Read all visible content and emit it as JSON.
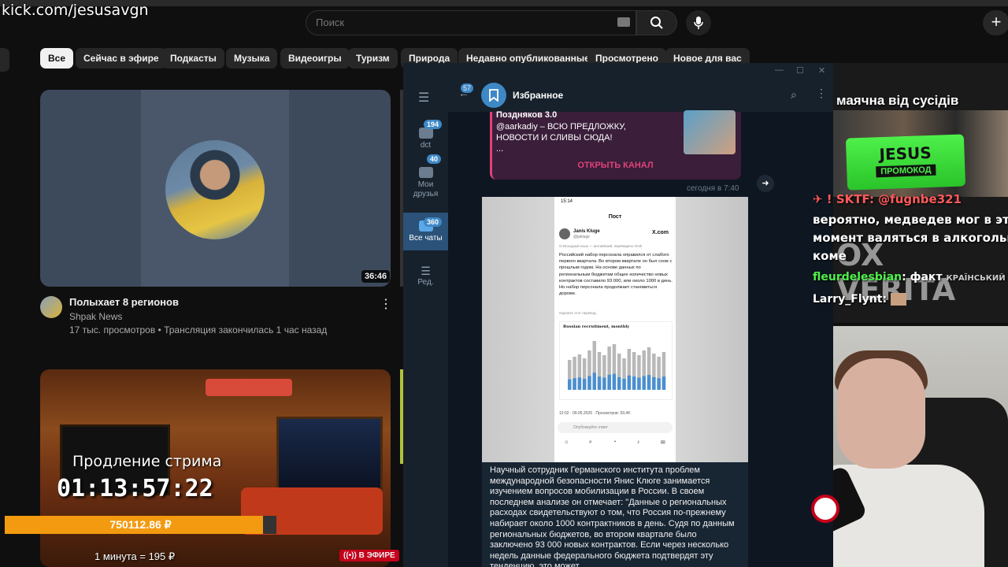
{
  "watermark": "kick.com/jesusavgn",
  "search": {
    "placeholder": "Поиск"
  },
  "chips": [
    "Все",
    "Сейчас в эфире",
    "Подкасты",
    "Музыка",
    "Видеоигры",
    "Туризм",
    "Природа",
    "Недавно опубликованные",
    "Просмотрено",
    "Новое для вас"
  ],
  "video1": {
    "duration": "36:46",
    "title": "Полыхает 8 регионов",
    "channel": "Shpak News",
    "meta": "17 тыс. просмотров • Трансляция закончилась 1 час назад"
  },
  "video2": {
    "extend_label": "Продление стрима",
    "timer": "01:13:57:22",
    "amount": "750112.86 ₽",
    "progress": 0.95,
    "rate": "1 минута = 195 ₽",
    "live": "В ЭФИРЕ"
  },
  "telegram": {
    "chat_title": "Избранное",
    "back_badge": "57",
    "folders": [
      {
        "label": "dct",
        "badge": "194"
      },
      {
        "label": "Мои друзья",
        "badge": "40"
      },
      {
        "label": "Все чаты",
        "badge": "360"
      },
      {
        "label": "Ред.",
        "badge": ""
      }
    ],
    "forward": {
      "title": "Поздняков 3.0",
      "text": "@aarkadiy – ВСЮ ПРЕДЛОЖКУ, НОВОСТИ И СЛИВЫ СЮДА!",
      "ellipsis": "...",
      "button": "ОТКРЫТЬ КАНАЛ",
      "time": "сегодня в 7:40"
    },
    "post": {
      "status_time": "15:14",
      "header": "Пост",
      "author": "Janis Kluge",
      "handle": "@jakluge",
      "site": "X.com",
      "translated": "О Исходный язык — английский, переведено Grok",
      "text": "Российский набор персонала оправился от слабого первого квартала. Во втором квартале он был схож с прошлым годом. На основе данных по региональным бюджетам общее количество новых контрактов составило 93 000, или около 1000 в день. Но набор персонала продолжает становиться дороже.",
      "rate_q": "Оцените этот перевод:",
      "chart_title": "Russian recruitment, monthly",
      "footer": "12:02 · 09.05.2026 · Просмотров: 59,4K",
      "reply": "Опубликуйте ответ"
    },
    "message": "Научный сотрудник Германского института проблем международной безопасности Янис Клюге занимается изучением вопросов мобилизации в России. В своем последнем анализе он отмечает: \"Данные о региональных расходах свидетельствуют о том, что Россия по-прежнему набирает около 1000 контрактников в день. Судя по данным региональных бюджетов, во втором квартале было заключено 93 000 новых контрактов. Если через несколько недель данные федерального бюджета подтвердят эту тенденцию, это может"
  },
  "overlay": {
    "title": "маячна від сусідів",
    "promo_top": "JESUS",
    "promo_bottom": "ПРОМОКОД",
    "chat": [
      {
        "user": "SKTF",
        "text": ": @fugnbe321"
      },
      {
        "user": "",
        "text": "вероятно, медведев мог в этот"
      },
      {
        "user": "",
        "text": "момент валяться в алкогольной"
      },
      {
        "user": "",
        "text": "коме"
      },
      {
        "user": "fleurdelesbian",
        "text": ": факт"
      },
      {
        "user": "Larry_Flynt",
        "text": ":"
      }
    ],
    "ghost": "OX VERITA",
    "ghost2": "КРАЇНСЬКИЙ ВІД"
  },
  "colors": {
    "accent_tg": "#3e88c6",
    "kick_orange": "#f39a10",
    "live_red": "#c4001a",
    "promo_green": "#4ef04a"
  }
}
